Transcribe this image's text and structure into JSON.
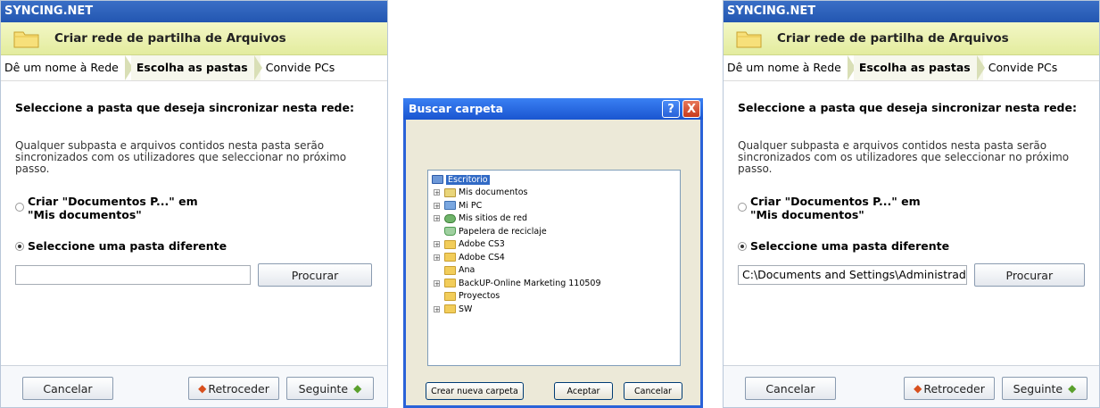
{
  "left_panel": {
    "app_title": "SYNCING.NET",
    "header_title": "Criar rede de partilha de Arquivos",
    "steps": [
      "Dê um nome à Rede",
      "Escolha as pastas",
      "Convide PCs"
    ],
    "question": "Seleccione a pasta que deseja sincronizar nesta rede:",
    "description": "Qualquer subpasta e arquivos contidos nesta pasta serão sincronizados com os utilizadores que seleccionar no próximo passo.",
    "option1_line1": "Criar \"Documentos P...\" em",
    "option1_line2": "\"Mis documentos\"",
    "option2": "Seleccione uma pasta diferente",
    "path_value": "",
    "browse_label": "Procurar",
    "cancel_label": "Cancelar",
    "back_label": "Retroceder",
    "next_label": "Seguinte"
  },
  "dialog": {
    "title": "Buscar carpeta",
    "help": "?",
    "close": "X",
    "tree": [
      {
        "label": "Escritorio",
        "icon": "desktop-icon",
        "expander": false,
        "root": true
      },
      {
        "label": "Mis documentos",
        "icon": "my-documents-icon",
        "expander": true
      },
      {
        "label": "Mi PC",
        "icon": "my-computer-icon",
        "expander": true
      },
      {
        "label": "Mis sitios de red",
        "icon": "network-places-icon",
        "expander": true
      },
      {
        "label": "Papelera de reciclaje",
        "icon": "recycle-bin-icon",
        "expander": false
      },
      {
        "label": "Adobe CS3",
        "icon": "folder-icon",
        "expander": true
      },
      {
        "label": "Adobe CS4",
        "icon": "folder-icon",
        "expander": true
      },
      {
        "label": "Ana",
        "icon": "folder-icon",
        "expander": false
      },
      {
        "label": "BackUP-Online Marketing 110509",
        "icon": "folder-icon",
        "expander": true
      },
      {
        "label": "Proyectos",
        "icon": "folder-icon",
        "expander": false
      },
      {
        "label": "SW",
        "icon": "folder-icon",
        "expander": true
      }
    ],
    "new_folder_label": "Crear nueva carpeta",
    "accept_label": "Aceptar",
    "cancel_label": "Cancelar"
  },
  "right_panel": {
    "app_title": "SYNCING.NET",
    "header_title": "Criar rede de partilha de Arquivos",
    "steps": [
      "Dê um nome à Rede",
      "Escolha as pastas",
      "Convide PCs"
    ],
    "question": "Seleccione a pasta que deseja sincronizar nesta rede:",
    "description": "Qualquer subpasta e arquivos contidos nesta pasta serão sincronizados com os utilizadores que seleccionar no próximo passo.",
    "option1_line1": "Criar \"Documentos P...\" em",
    "option1_line2": "\"Mis documentos\"",
    "option2": "Seleccione uma pasta diferente",
    "path_value": "C:\\Documents and Settings\\Administradc",
    "browse_label": "Procurar",
    "cancel_label": "Cancelar",
    "back_label": "Retroceder",
    "next_label": "Seguinte"
  }
}
